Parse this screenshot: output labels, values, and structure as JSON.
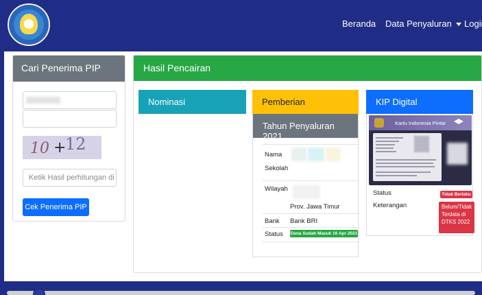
{
  "nav": {
    "links": {
      "beranda": "Beranda",
      "data_penyaluran": "Data Penyaluran",
      "login": "Login"
    },
    "background_color": "#1f2d86"
  },
  "search": {
    "title": "Cari Penerima PIP",
    "captcha": {
      "a": "10",
      "op": "+",
      "b": "12"
    },
    "answer_placeholder": "Ketik Hasil perhitungan di",
    "submit_label": "Cek Penerima PIP"
  },
  "result": {
    "title": "Hasil Pencairan",
    "nominasi": {
      "title": "Nominasi"
    },
    "pemberian": {
      "title": "Pemberian",
      "year_title": "Tahun Penyaluran 2021",
      "labels": {
        "nama": "Nama",
        "sekolah": "Sekolah",
        "wilayah": "Wilayah",
        "bank": "Bank",
        "status": "Status"
      },
      "values": {
        "province": "Prov. Jawa Timur",
        "bank": "Bank BRI",
        "status": "Dana Sudah Masuk 16 Apr 2021"
      }
    },
    "kip": {
      "title": "KIP Digital",
      "card_title": "Kartu Indonesia Pintar",
      "status_label": "Status",
      "status_badge": "Tidak Berlaku",
      "keterangan_label": "Keterangan",
      "keterangan_badge": "Belum/Tidak Terdata di DTKS 2022"
    }
  },
  "colors": {
    "success": "#28a745",
    "info": "#17a2b8",
    "warning": "#ffc107",
    "primary": "#0d6efd",
    "secondary": "#6c757d",
    "danger": "#dc3545"
  }
}
